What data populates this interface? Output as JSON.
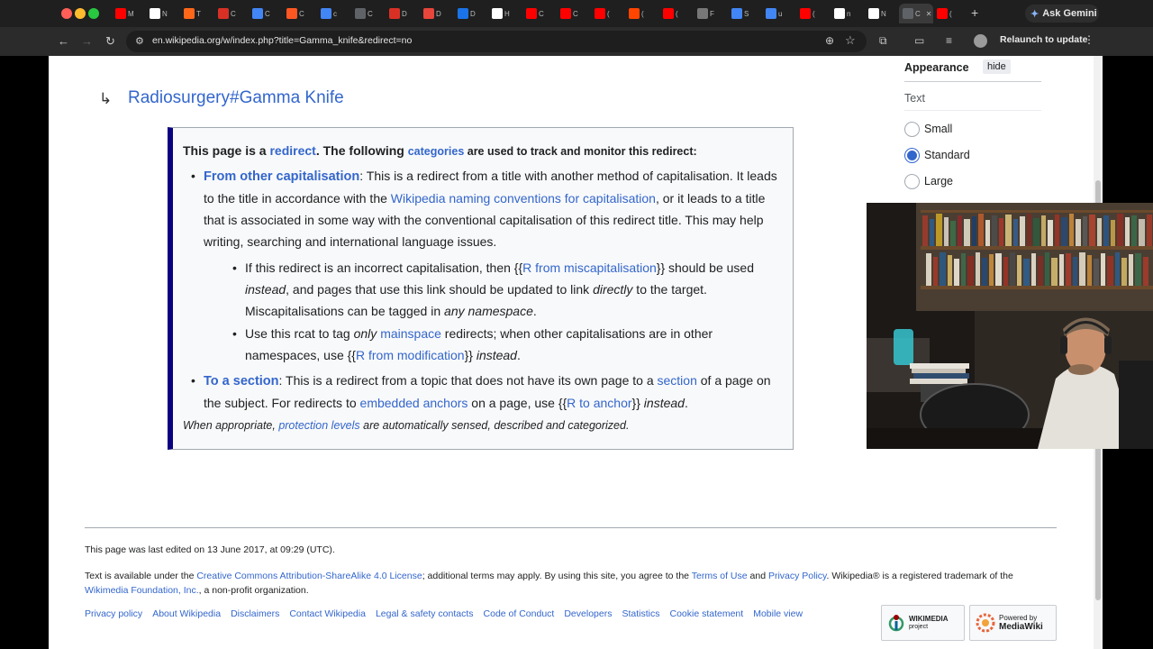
{
  "browser": {
    "tabs": [
      {
        "icon": "youtube-icon",
        "color": "#ff0000",
        "label": "M"
      },
      {
        "icon": "wikipedia-icon",
        "color": "#ffffff",
        "label": "N"
      },
      {
        "icon": "substack-icon",
        "color": "#ff6719",
        "label": "T"
      },
      {
        "icon": "gmail-icon",
        "color": "#d93025",
        "label": "C"
      },
      {
        "icon": "google-icon",
        "color": "#4285f4",
        "label": "C"
      },
      {
        "icon": "blogger-icon",
        "color": "#ff5722",
        "label": "C"
      },
      {
        "icon": "google-icon",
        "color": "#4285f4",
        "label": "c"
      },
      {
        "icon": "generic-icon",
        "color": "#5f6368",
        "label": "C"
      },
      {
        "icon": "gmail-icon",
        "color": "#d93025",
        "label": "D"
      },
      {
        "icon": "x-icon",
        "color": "#e8453c",
        "label": "D"
      },
      {
        "icon": "generic-icon",
        "color": "#1a73e8",
        "label": "D"
      },
      {
        "icon": "notion-icon",
        "color": "#ffffff",
        "label": "H"
      },
      {
        "icon": "youtube-icon",
        "color": "#ff0000",
        "label": "C"
      },
      {
        "icon": "youtube-icon",
        "color": "#ff0000",
        "label": "C"
      },
      {
        "icon": "youtube-icon",
        "color": "#ff0000",
        "label": "("
      },
      {
        "icon": "reddit-icon",
        "color": "#ff4500",
        "label": "("
      },
      {
        "icon": "youtube-icon",
        "color": "#ff0000",
        "label": "("
      },
      {
        "icon": "generic-icon",
        "color": "#777777",
        "label": "F"
      },
      {
        "icon": "google-icon",
        "color": "#4285f4",
        "label": "S"
      },
      {
        "icon": "google-icon",
        "color": "#4285f4",
        "label": "u"
      },
      {
        "icon": "youtube-icon",
        "color": "#ff0000",
        "label": "("
      },
      {
        "icon": "chatgpt-icon",
        "color": "#ffffff",
        "label": "n"
      },
      {
        "icon": "wikipedia-icon",
        "color": "#ffffff",
        "label": "N"
      },
      {
        "icon": "generic-icon",
        "color": "#5f6368",
        "label": "C"
      },
      {
        "icon": "youtube-icon",
        "color": "#ff0000",
        "label": "("
      }
    ],
    "new_tab": "+",
    "ask_gemini": "Ask Gemini",
    "url": "en.wikipedia.org/w/index.php?title=Gamma_knife&redirect=no",
    "relaunch": "Relaunch to update"
  },
  "page": {
    "redirect_arrow": "↳",
    "redirect_target": "Radiosurgery#Gamma Knife",
    "rcat": {
      "head_prefix": "This page is a ",
      "head_redirect": "redirect",
      "head_mid": ". The following ",
      "head_categories": "categories",
      "head_suffix": " are used to track and monitor this redirect:",
      "item1_title": "From other capitalisation",
      "item1_a": ": This is a redirect from a title with another method of capitalisation. It leads to the title in accordance with the ",
      "item1_link": "Wikipedia naming conventions for capitalisation",
      "item1_b": ", or it leads to a title that is associated in some way with the conventional capitalisation of this redirect title. This may help writing, searching and international language issues.",
      "sub1_a": "If this redirect is an incorrect capitalisation, then {{",
      "sub1_link": "R from miscapitalisation",
      "sub1_b": "}} should be used ",
      "sub1_instead": "instead",
      "sub1_c": ", and pages that use this link should be updated to link ",
      "sub1_directly": "directly",
      "sub1_d": " to the target. Miscapitalisations can be tagged in ",
      "sub1_any": "any namespace",
      "sub1_e": ".",
      "sub2_a": "Use this rcat to tag ",
      "sub2_only": "only",
      "sub2_space": " ",
      "sub2_link": "mainspace",
      "sub2_b": " redirects; when other capitalisations are in other namespaces, use {{",
      "sub2_link2": "R from modification",
      "sub2_c": "}} ",
      "sub2_instead": "instead",
      "sub2_d": ".",
      "item2_title": "To a section",
      "item2_a": ": This is a redirect from a topic that does not have its own page to a ",
      "item2_link": "section",
      "item2_b": " of a page on the subject. For redirects to ",
      "item2_link2": "embedded anchors",
      "item2_c": " on a page, use {{",
      "item2_link3": "R to anchor",
      "item2_d": "}} ",
      "item2_instead": "instead",
      "item2_e": ".",
      "foot_a": "When appropriate, ",
      "foot_link": "protection levels",
      "foot_b": " are automatically sensed, described and categorized."
    },
    "appearance": {
      "title": "Appearance",
      "hide": "hide",
      "text_label": "Text",
      "options": [
        {
          "label": "Small",
          "selected": false
        },
        {
          "label": "Standard",
          "selected": true
        },
        {
          "label": "Large",
          "selected": false
        }
      ]
    },
    "footer": {
      "last_edited": "This page was last edited on 13 June 2017, at 09:29 (UTC).",
      "license_a": "Text is available under the ",
      "license_link": "Creative Commons Attribution-ShareAlike 4.0 License",
      "license_b": "; additional terms may apply. By using this site, you agree to the ",
      "terms_link": "Terms of Use",
      "and": " and ",
      "privacy_link": "Privacy Policy",
      "license_c": ". Wikipedia® is a registered trademark of the ",
      "wmf_link": "Wikimedia Foundation, Inc.",
      "license_d": ", a non-profit organization.",
      "links": [
        "Privacy policy",
        "About Wikipedia",
        "Disclaimers",
        "Contact Wikipedia",
        "Legal & safety contacts",
        "Code of Conduct",
        "Developers",
        "Statistics",
        "Cookie statement",
        "Mobile view"
      ],
      "wikimedia_badge": [
        "WIKIMEDIA",
        "project"
      ],
      "mediawiki_badge": [
        "Powered by",
        "MediaWiki"
      ]
    }
  }
}
